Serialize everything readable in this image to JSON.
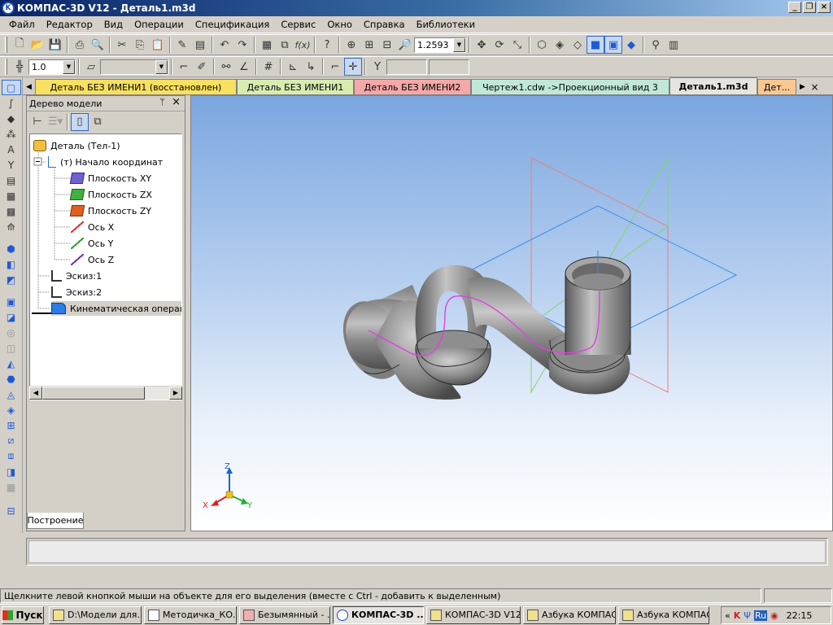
{
  "window": {
    "title": "КОМПАС-3D V12 - Деталь1.m3d",
    "icon_text": "K",
    "min": "_",
    "restore": "❐",
    "close": "×"
  },
  "menu": [
    "Файл",
    "Редактор",
    "Вид",
    "Операции",
    "Спецификация",
    "Сервис",
    "Окно",
    "Справка",
    "Библиотеки"
  ],
  "toolbar1": {
    "zoom_value": "1.2593"
  },
  "toolbar2": {
    "step_value": "1.0"
  },
  "tabs": [
    {
      "label": "Деталь БЕЗ ИМЕНИ1 (восстановлен)",
      "color": "#f8e060"
    },
    {
      "label": "Деталь БЕЗ ИМЕНИ1",
      "color": "#d8ecb0"
    },
    {
      "label": "Деталь БЕЗ ИМЕНИ2",
      "color": "#f5a8a8"
    },
    {
      "label": "Чертеж1.cdw ->Проекционный вид 3",
      "color": "#bfe8d8"
    },
    {
      "label": "Деталь1.m3d",
      "color": "#e6e4df"
    },
    {
      "label": "Дет...",
      "color": "#f8c890"
    }
  ],
  "tree_panel": {
    "title": "Дерево модели",
    "pin": "ᛘ",
    "close": "×",
    "bottom_tab": "Построение",
    "nodes": [
      {
        "label": "Деталь (Тел-1)"
      },
      {
        "label": "(т) Начало координат"
      },
      {
        "label": "Плоскость XY"
      },
      {
        "label": "Плоскость ZX"
      },
      {
        "label": "Плоскость ZY"
      },
      {
        "label": "Ось X"
      },
      {
        "label": "Ось Y"
      },
      {
        "label": "Ось Z"
      },
      {
        "label": "Эскиз:1"
      },
      {
        "label": "Эскиз:2"
      },
      {
        "label": "Кинематическая операция"
      }
    ]
  },
  "axes": {
    "x": "X",
    "y": "Y",
    "z": "Z"
  },
  "status_text": "Щелкните левой кнопкой мыши на объекте для его выделения (вместе с Ctrl - добавить к выделенным)",
  "taskbar": {
    "start": "Пуск",
    "tasks": [
      {
        "label": "D:\\Модели для..."
      },
      {
        "label": "Методичка_КО..."
      },
      {
        "label": "Безымянный - ..."
      },
      {
        "label": "КОМПАС-3D ..."
      },
      {
        "label": "КОМПАС-3D V12"
      },
      {
        "label": "Азбука КОМПАС"
      },
      {
        "label": "Азбука КОМПАС"
      }
    ],
    "lang": "Ru",
    "clock": "22:15"
  }
}
